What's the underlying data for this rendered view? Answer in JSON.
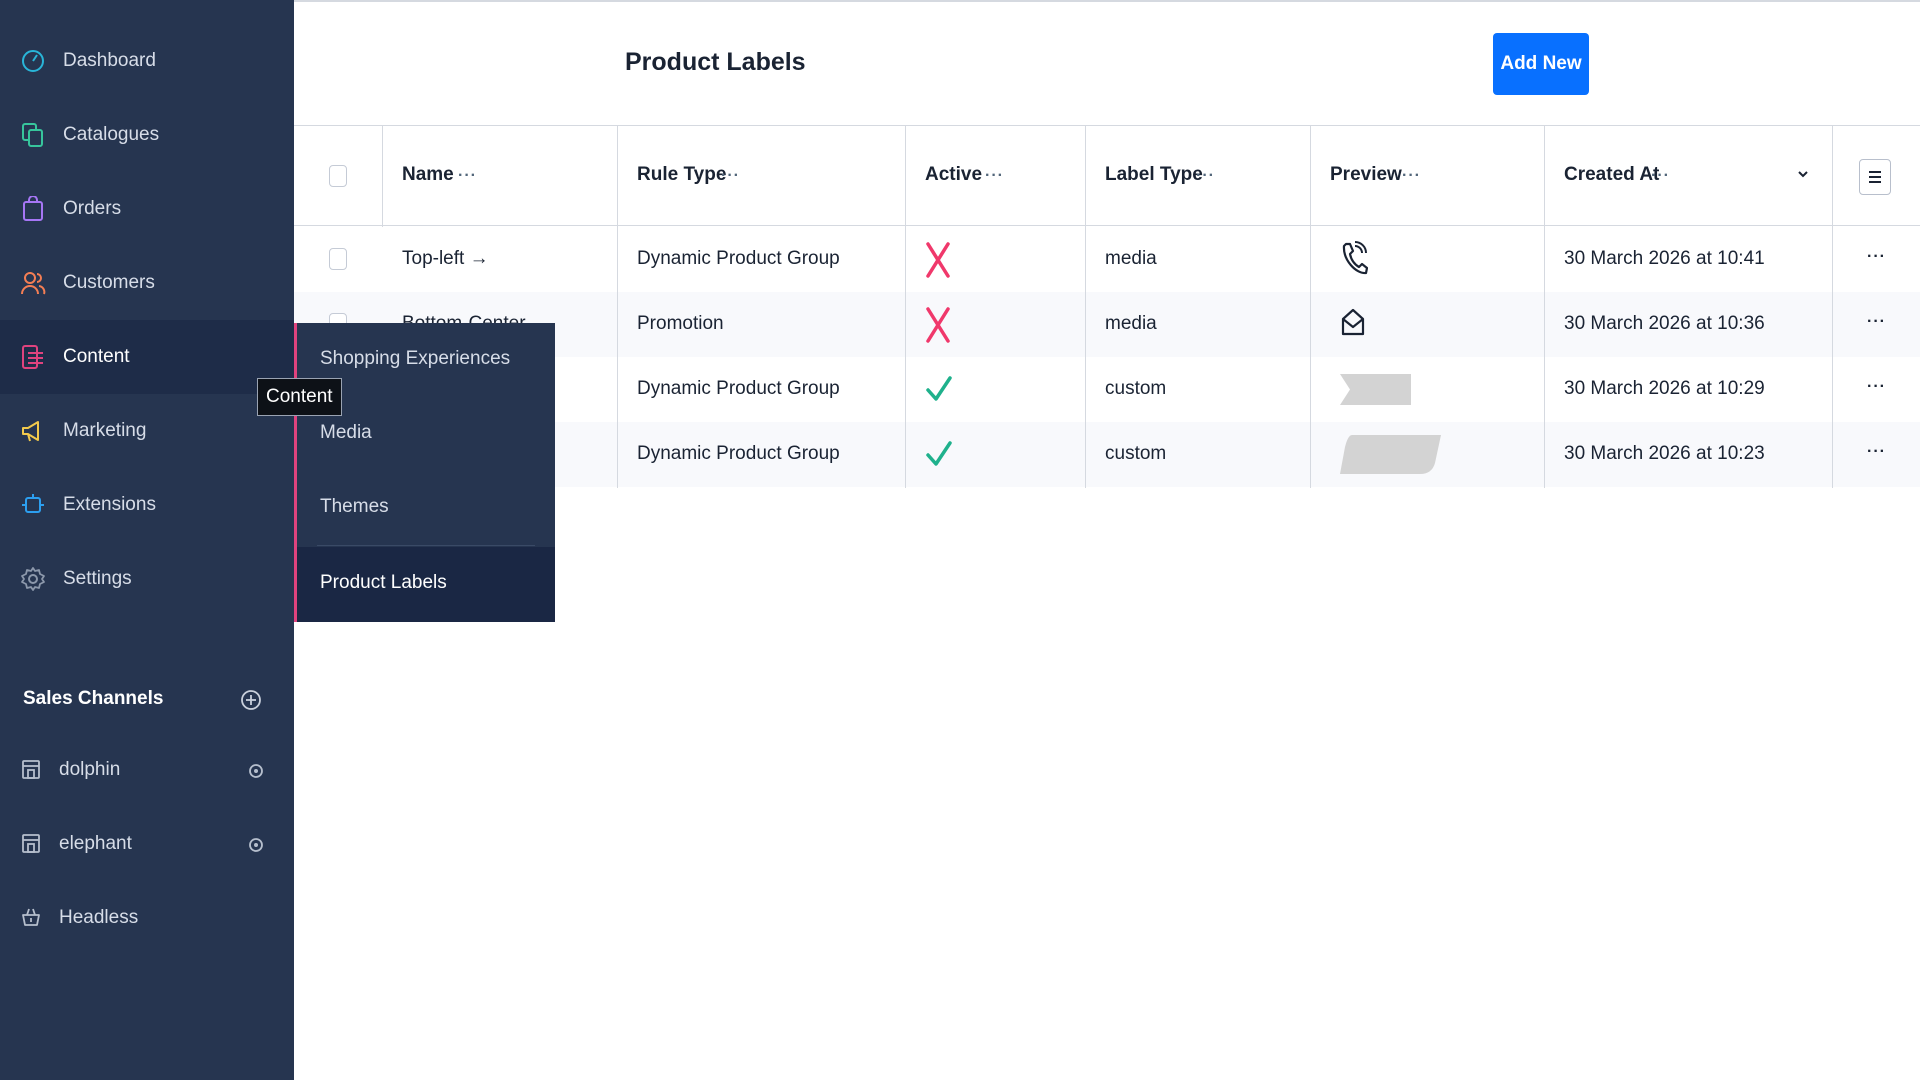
{
  "sidebar": {
    "items": [
      {
        "label": "Dashboard",
        "icon": "dashboard-icon"
      },
      {
        "label": "Catalogues",
        "icon": "catalogues-icon"
      },
      {
        "label": "Orders",
        "icon": "orders-icon"
      },
      {
        "label": "Customers",
        "icon": "customers-icon"
      },
      {
        "label": "Content",
        "icon": "content-icon"
      },
      {
        "label": "Marketing",
        "icon": "marketing-icon"
      },
      {
        "label": "Extensions",
        "icon": "extensions-icon"
      },
      {
        "label": "Settings",
        "icon": "settings-icon"
      }
    ],
    "sales_channels": {
      "title": "Sales Channels",
      "items": [
        {
          "label": "dolphin",
          "icon": "storefront-icon"
        },
        {
          "label": "elephant",
          "icon": "storefront-icon"
        },
        {
          "label": "Headless",
          "icon": "basket-icon"
        }
      ]
    }
  },
  "flyout": {
    "items": [
      {
        "label": "Shopping Experiences"
      },
      {
        "label": "Media"
      },
      {
        "label": "Themes"
      },
      {
        "label": "Product Labels"
      }
    ]
  },
  "tooltip": "Content",
  "header": {
    "title": "Product Labels",
    "add_button": "Add New"
  },
  "table": {
    "columns": [
      "Name",
      "Rule Type",
      "Active",
      "Label Type",
      "Preview",
      "Created At"
    ],
    "column_menu": "···",
    "row_menu": "···",
    "rows": [
      {
        "name": "Top-left →",
        "rule_type": "Dynamic Product Group",
        "active": false,
        "label_type": "media",
        "preview": "phone-icon",
        "created_at": "30 March 2026 at 10:41"
      },
      {
        "name": "Bottom-Center →",
        "rule_type": "Promotion",
        "active": false,
        "label_type": "media",
        "preview": "envelope-open-icon",
        "created_at": "30 March 2026 at 10:36"
      },
      {
        "name": "",
        "rule_type": "Dynamic Product Group",
        "active": true,
        "label_type": "custom",
        "preview": "ribbon-shape",
        "created_at": "30 March 2026 at 10:29"
      },
      {
        "name": "",
        "rule_type": "Dynamic Product Group",
        "active": true,
        "label_type": "custom",
        "preview": "slanted-shape",
        "created_at": "30 March 2026 at 10:23"
      }
    ]
  },
  "colors": {
    "sidebar_bg": "#263550",
    "accent_blue": "#0870ff",
    "inactive_x": "#f0386b",
    "active_check": "#1fb18c",
    "flyout_accent": "#e0437e"
  }
}
